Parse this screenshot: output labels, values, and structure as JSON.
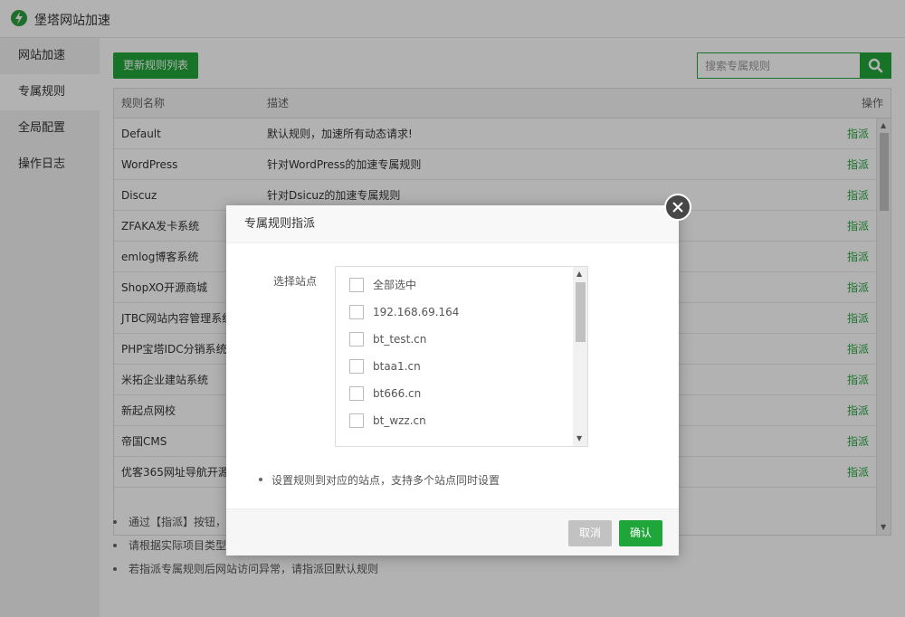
{
  "app": {
    "title": "堡塔网站加速"
  },
  "sidebar": {
    "items": [
      {
        "label": "网站加速"
      },
      {
        "label": "专属规则"
      },
      {
        "label": "全局配置"
      },
      {
        "label": "操作日志"
      }
    ]
  },
  "toolbar": {
    "update_label": "更新规则列表",
    "search_placeholder": "搜索专属规则"
  },
  "table": {
    "headers": {
      "name": "规则名称",
      "desc": "描述",
      "op": "操作"
    },
    "rows": [
      {
        "name": "Default",
        "desc": "默认规则，加速所有动态请求!",
        "op": "指派"
      },
      {
        "name": "WordPress",
        "desc": "针对WordPress的加速专属规则",
        "op": "指派"
      },
      {
        "name": "Discuz",
        "desc": "针对Dsicuz的加速专属规则",
        "op": "指派"
      },
      {
        "name": "ZFAKA发卡系统",
        "desc": "",
        "op": "指派"
      },
      {
        "name": "emlog博客系统",
        "desc": "",
        "op": "指派"
      },
      {
        "name": "ShopXO开源商城",
        "desc": "",
        "op": "指派"
      },
      {
        "name": "JTBC网站内容管理系统",
        "desc": "",
        "op": "指派"
      },
      {
        "name": "PHP宝塔IDC分销系统",
        "desc": "",
        "op": "指派"
      },
      {
        "name": "米拓企业建站系统",
        "desc": "",
        "op": "指派"
      },
      {
        "name": "新起点网校",
        "desc": "",
        "op": "指派"
      },
      {
        "name": "帝国CMS",
        "desc": "",
        "op": "指派"
      },
      {
        "name": "优客365网址导航开源",
        "desc": "",
        "op": "指派"
      }
    ]
  },
  "tips": [
    "通过【指派】按钮，",
    "请根据实际项目类型",
    "若指派专属规则后网站访问异常，请指派回默认规则"
  ],
  "dialog": {
    "title": "专属规则指派",
    "select_label": "选择站点",
    "options": [
      {
        "label": "全部选中"
      },
      {
        "label": "192.168.69.164"
      },
      {
        "label": "bt_test.cn"
      },
      {
        "label": "btaa1.cn"
      },
      {
        "label": "bt666.cn"
      },
      {
        "label": "bt_wzz.cn"
      }
    ],
    "tip": "设置规则到对应的站点，支持多个站点同时设置",
    "cancel_label": "取消",
    "ok_label": "确认"
  },
  "colors": {
    "accent": "#20a53a",
    "cancel": "#c2c2c2"
  }
}
